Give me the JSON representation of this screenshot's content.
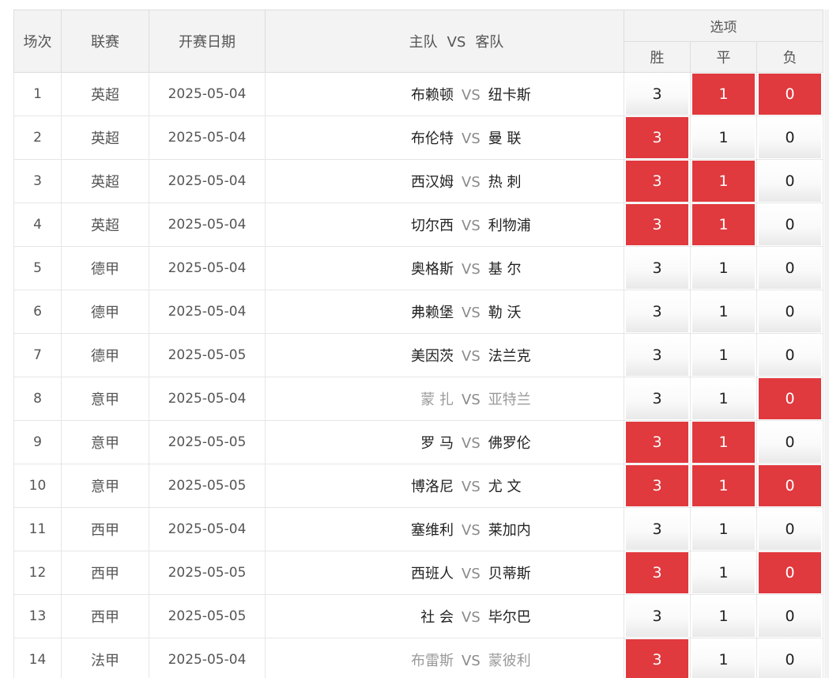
{
  "header": {
    "col_index": "场次",
    "col_league": "联赛",
    "col_date": "开赛日期",
    "col_home": "主队",
    "col_vs": "VS",
    "col_away": "客队",
    "options_group": "选项",
    "opt_win": "胜",
    "opt_draw": "平",
    "opt_lose": "负"
  },
  "vs_label": "VS",
  "colors": {
    "selected": "#e0393e",
    "muted_text": "#9a9a9a"
  },
  "rows": [
    {
      "index": "1",
      "league": "英超",
      "date": "2025-05-04",
      "home": "布赖顿",
      "away": "纽卡斯",
      "muted": false,
      "win": {
        "label": "3",
        "selected": false
      },
      "draw": {
        "label": "1",
        "selected": true
      },
      "lose": {
        "label": "0",
        "selected": true
      }
    },
    {
      "index": "2",
      "league": "英超",
      "date": "2025-05-04",
      "home": "布伦特",
      "away": "曼 联",
      "muted": false,
      "win": {
        "label": "3",
        "selected": true
      },
      "draw": {
        "label": "1",
        "selected": false
      },
      "lose": {
        "label": "0",
        "selected": false
      }
    },
    {
      "index": "3",
      "league": "英超",
      "date": "2025-05-04",
      "home": "西汉姆",
      "away": "热 刺",
      "muted": false,
      "win": {
        "label": "3",
        "selected": true
      },
      "draw": {
        "label": "1",
        "selected": true
      },
      "lose": {
        "label": "0",
        "selected": false
      }
    },
    {
      "index": "4",
      "league": "英超",
      "date": "2025-05-04",
      "home": "切尔西",
      "away": "利物浦",
      "muted": false,
      "win": {
        "label": "3",
        "selected": true
      },
      "draw": {
        "label": "1",
        "selected": true
      },
      "lose": {
        "label": "0",
        "selected": false
      }
    },
    {
      "index": "5",
      "league": "德甲",
      "date": "2025-05-04",
      "home": "奥格斯",
      "away": "基 尔",
      "muted": false,
      "win": {
        "label": "3",
        "selected": false
      },
      "draw": {
        "label": "1",
        "selected": false
      },
      "lose": {
        "label": "0",
        "selected": false
      }
    },
    {
      "index": "6",
      "league": "德甲",
      "date": "2025-05-04",
      "home": "弗赖堡",
      "away": "勒 沃",
      "muted": false,
      "win": {
        "label": "3",
        "selected": false
      },
      "draw": {
        "label": "1",
        "selected": false
      },
      "lose": {
        "label": "0",
        "selected": false
      }
    },
    {
      "index": "7",
      "league": "德甲",
      "date": "2025-05-05",
      "home": "美因茨",
      "away": "法兰克",
      "muted": false,
      "win": {
        "label": "3",
        "selected": false
      },
      "draw": {
        "label": "1",
        "selected": false
      },
      "lose": {
        "label": "0",
        "selected": false
      }
    },
    {
      "index": "8",
      "league": "意甲",
      "date": "2025-05-04",
      "home": "蒙 扎",
      "away": "亚特兰",
      "muted": true,
      "win": {
        "label": "3",
        "selected": false
      },
      "draw": {
        "label": "1",
        "selected": false
      },
      "lose": {
        "label": "0",
        "selected": true
      }
    },
    {
      "index": "9",
      "league": "意甲",
      "date": "2025-05-05",
      "home": "罗 马",
      "away": "佛罗伦",
      "muted": false,
      "win": {
        "label": "3",
        "selected": true
      },
      "draw": {
        "label": "1",
        "selected": true
      },
      "lose": {
        "label": "0",
        "selected": false
      }
    },
    {
      "index": "10",
      "league": "意甲",
      "date": "2025-05-05",
      "home": "博洛尼",
      "away": "尤 文",
      "muted": false,
      "win": {
        "label": "3",
        "selected": true
      },
      "draw": {
        "label": "1",
        "selected": true
      },
      "lose": {
        "label": "0",
        "selected": true
      }
    },
    {
      "index": "11",
      "league": "西甲",
      "date": "2025-05-04",
      "home": "塞维利",
      "away": "莱加内",
      "muted": false,
      "win": {
        "label": "3",
        "selected": false
      },
      "draw": {
        "label": "1",
        "selected": false
      },
      "lose": {
        "label": "0",
        "selected": false
      }
    },
    {
      "index": "12",
      "league": "西甲",
      "date": "2025-05-05",
      "home": "西班人",
      "away": "贝蒂斯",
      "muted": false,
      "win": {
        "label": "3",
        "selected": true
      },
      "draw": {
        "label": "1",
        "selected": false
      },
      "lose": {
        "label": "0",
        "selected": true
      }
    },
    {
      "index": "13",
      "league": "西甲",
      "date": "2025-05-05",
      "home": "社 会",
      "away": "毕尔巴",
      "muted": false,
      "win": {
        "label": "3",
        "selected": false
      },
      "draw": {
        "label": "1",
        "selected": false
      },
      "lose": {
        "label": "0",
        "selected": false
      }
    },
    {
      "index": "14",
      "league": "法甲",
      "date": "2025-05-04",
      "home": "布雷斯",
      "away": "蒙彼利",
      "muted": true,
      "win": {
        "label": "3",
        "selected": true
      },
      "draw": {
        "label": "1",
        "selected": false
      },
      "lose": {
        "label": "0",
        "selected": false
      }
    }
  ]
}
